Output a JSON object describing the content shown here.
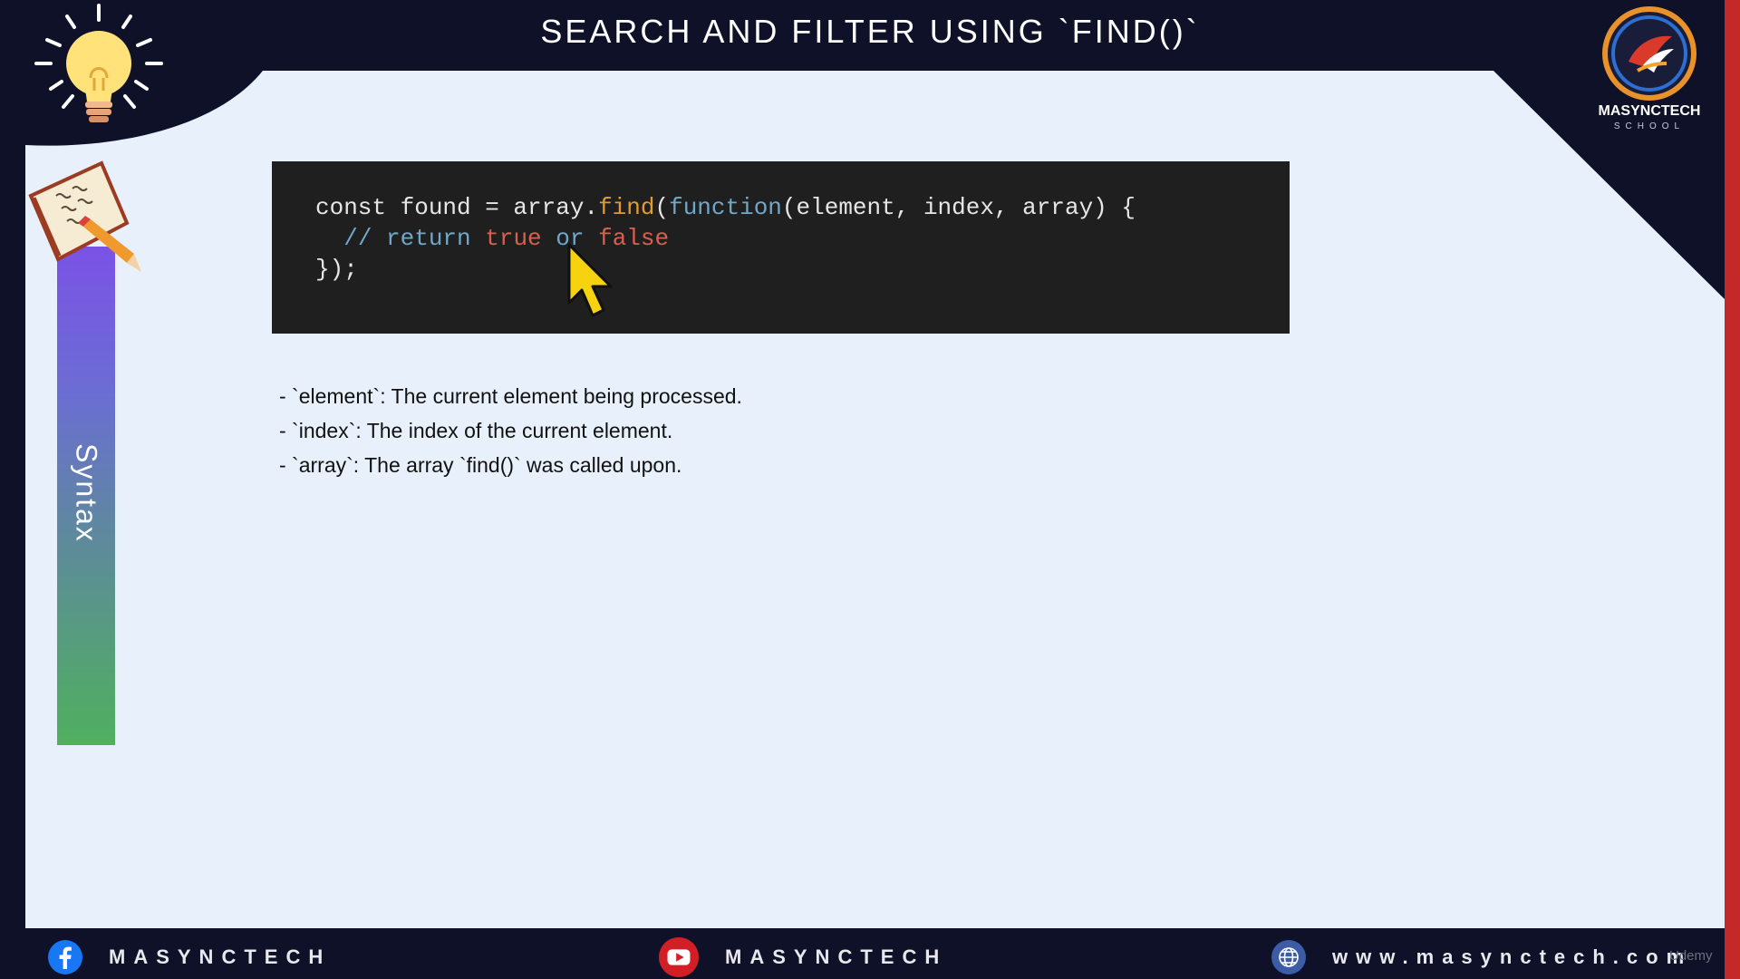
{
  "slide": {
    "title": "SEARCH AND FILTER USING `FIND()`",
    "section_label": "Syntax"
  },
  "logo": {
    "name": "MASYNCTECH",
    "subtitle": "SCHOOL"
  },
  "code_block": {
    "line1": {
      "part1": "const found = array.",
      "method": "find",
      "part2": "(",
      "keyword": "function",
      "part3": "(element, index, array) {"
    },
    "line2": {
      "indent": "  ",
      "comment": "// return ",
      "true_kw": "true",
      "or_kw": " or ",
      "false_kw": "false"
    },
    "line3": "});"
  },
  "parameters": [
    "- `element`: The current element being processed.",
    "- `index`: The index of the current element.",
    "- `array`: The array `find()` was called upon."
  ],
  "footer": {
    "facebook": {
      "icon": "facebook-icon",
      "label": "MASYNCTECH"
    },
    "youtube": {
      "icon": "youtube-icon",
      "label": "MASYNCTECH"
    },
    "website": {
      "icon": "globe-icon",
      "label": "www.masynctech.com"
    },
    "watermark": "Udemy"
  },
  "colors": {
    "background": "#0e1128",
    "slide_panel": "#e8f1fb",
    "code_bg": "#1f1f1f",
    "accent_red": "#c4292a"
  }
}
